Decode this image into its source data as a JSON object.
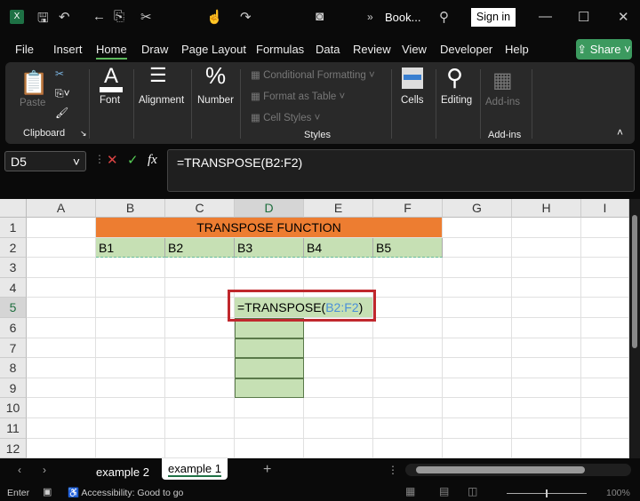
{
  "titlebar": {
    "doc_title": "Book...",
    "sign_in": "Sign in",
    "overflow": "»"
  },
  "tabs": [
    "File",
    "Insert",
    "Home",
    "Draw",
    "Page Layout",
    "Formulas",
    "Data",
    "Review",
    "View",
    "Developer",
    "Help"
  ],
  "active_tab": "Home",
  "share": "Share",
  "ribbon": {
    "paste": "Paste",
    "clipboard": "Clipboard",
    "font": "Font",
    "alignment": "Alignment",
    "number": "Number",
    "conditional": "Conditional Formatting",
    "format_table": "Format as Table",
    "cell_styles": "Cell Styles",
    "styles": "Styles",
    "cells": "Cells",
    "editing": "Editing",
    "addins_btn": "Add-ins",
    "addins_group": "Add-ins"
  },
  "formula_bar": {
    "name_box": "D5",
    "fx": "fx",
    "formula": "=TRANSPOSE(B2:F2)"
  },
  "columns": [
    "A",
    "B",
    "C",
    "D",
    "E",
    "F",
    "G",
    "H",
    "I"
  ],
  "rows": [
    "1",
    "2",
    "3",
    "4",
    "5",
    "6",
    "7",
    "8",
    "9",
    "10",
    "11",
    "12"
  ],
  "cells": {
    "title": "TRANSPOSE FUNCTION",
    "row2": [
      "B1",
      "B2",
      "B3",
      "B4",
      "B5"
    ],
    "d5_prefix": "=TRANSPOSE(",
    "d5_ref": "B2:F2",
    "d5_suffix": ")"
  },
  "colors": {
    "title_fill": "#ed7d31",
    "data_fill": "#c6e0b4",
    "ref_color": "#4a90d9",
    "highlight_box": "#c0282d",
    "accent": "#1e7145"
  },
  "sheets": [
    "example 2",
    "example 1"
  ],
  "active_sheet": "example 1",
  "status": {
    "mode": "Enter",
    "accessibility": "Accessibility: Good to go",
    "zoom": "100%"
  }
}
